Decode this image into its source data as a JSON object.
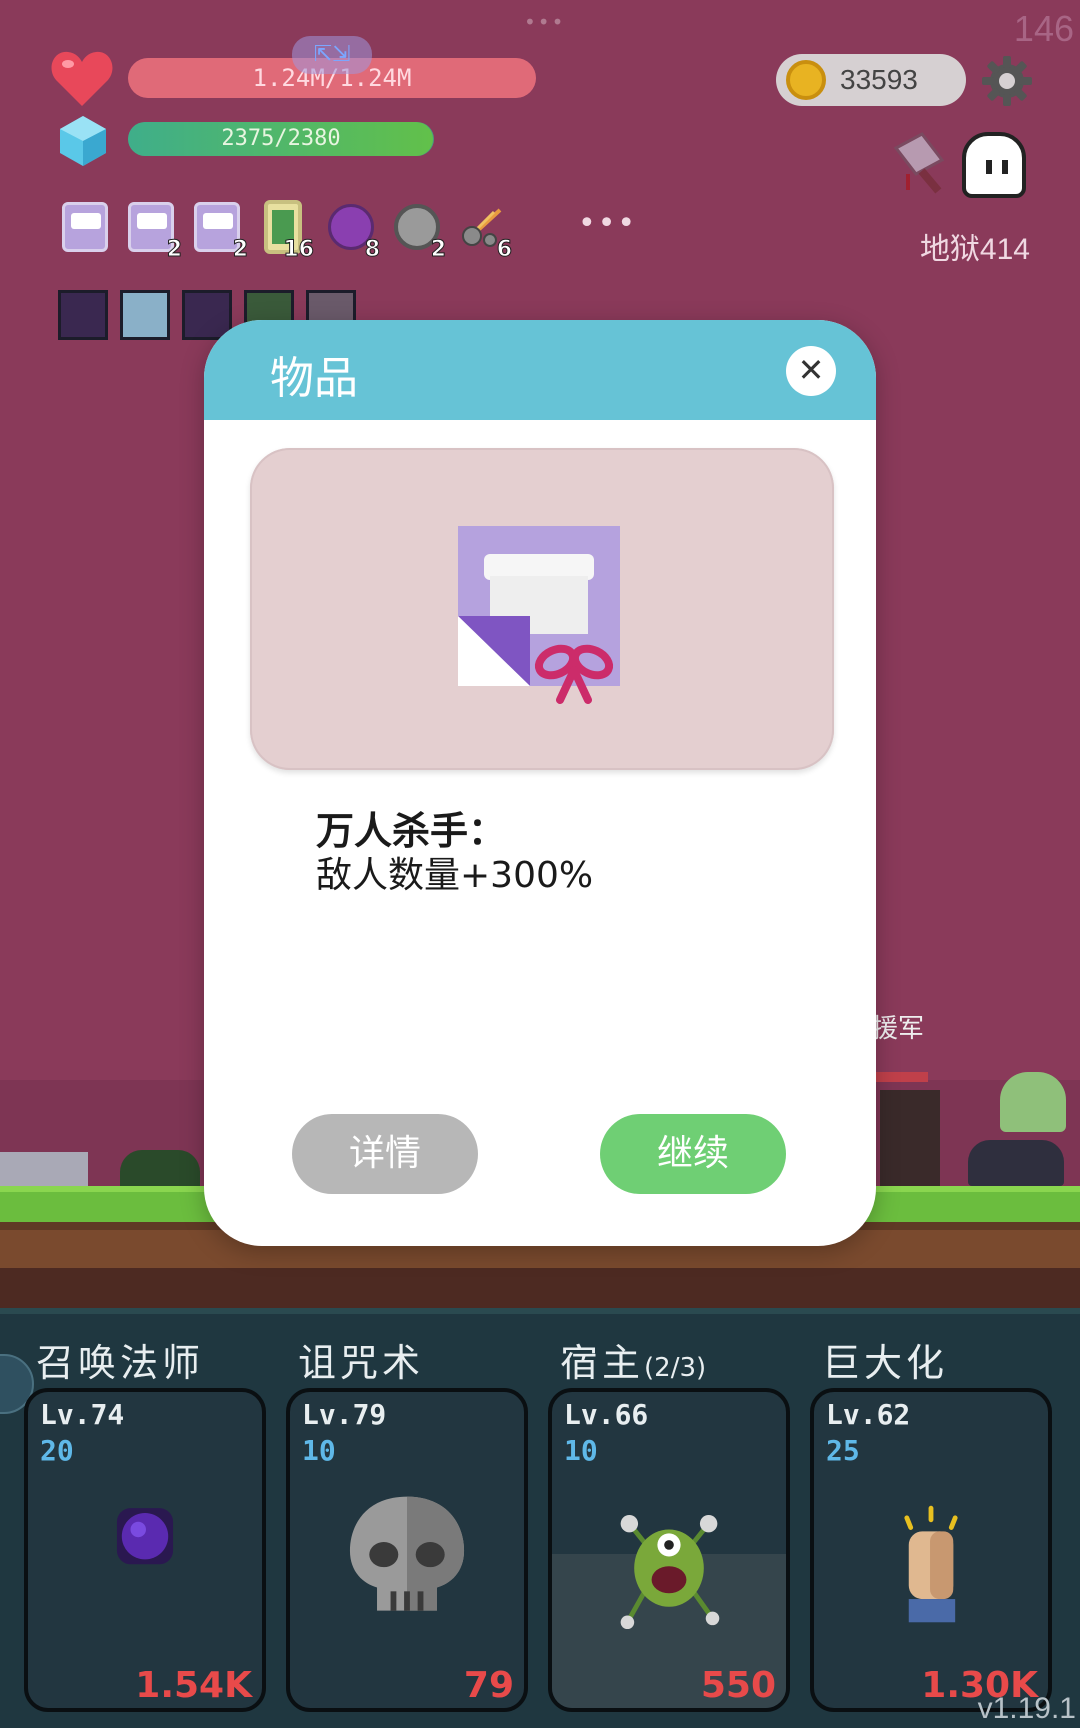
{
  "hud": {
    "fps": "146",
    "hp_text": "1.24M/1.24M",
    "hp_fraction": 1.0,
    "mp_text": "2375/2380",
    "mp_fraction": 0.998,
    "gold": "33593",
    "stage": "地狱414"
  },
  "inventory": [
    {
      "icon": "gift-scroll-icon",
      "count": ""
    },
    {
      "icon": "gift-scroll-icon",
      "count": "2"
    },
    {
      "icon": "gift-scroll-icon",
      "count": "2"
    },
    {
      "icon": "phone-icon",
      "count": "16"
    },
    {
      "icon": "potion-icon",
      "count": "8"
    },
    {
      "icon": "compass-icon",
      "count": "2"
    },
    {
      "icon": "meteor-icon",
      "count": "6"
    }
  ],
  "inventory_more": "•••",
  "buffs": [
    "demon-mask-icon",
    "light-bulb-icon",
    "demon-mask-icon",
    "check-icon",
    "sword-icon"
  ],
  "npc_name": "援军",
  "modal": {
    "title": "物品",
    "close_label": "✕",
    "item_name": "万人杀手：",
    "item_effect": "敌人数量+300%",
    "details_label": "详情",
    "continue_label": "继续"
  },
  "skills": [
    {
      "title": "召唤法师",
      "sub": "",
      "level": "Lv.74",
      "cost": "20",
      "price": "1.54K",
      "icon": "dark-orb-icon"
    },
    {
      "title": "诅咒术",
      "sub": "",
      "level": "Lv.79",
      "cost": "10",
      "price": "79",
      "icon": "skull-icon"
    },
    {
      "title": "宿主",
      "sub": "(2/3)",
      "level": "Lv.66",
      "cost": "10",
      "price": "550",
      "icon": "green-monster-icon"
    },
    {
      "title": "巨大化",
      "sub": "",
      "level": "Lv.62",
      "cost": "25",
      "price": "1.30K",
      "icon": "raised-fist-icon"
    }
  ],
  "version": "v1.19.1",
  "colors": {
    "background": "#8a3a5a",
    "modal_header": "#66c3d6",
    "continue_button": "#6fcf74",
    "details_button": "#b7b7b7",
    "price_text": "#e84a4a",
    "cost_text": "#5fb8e8"
  }
}
